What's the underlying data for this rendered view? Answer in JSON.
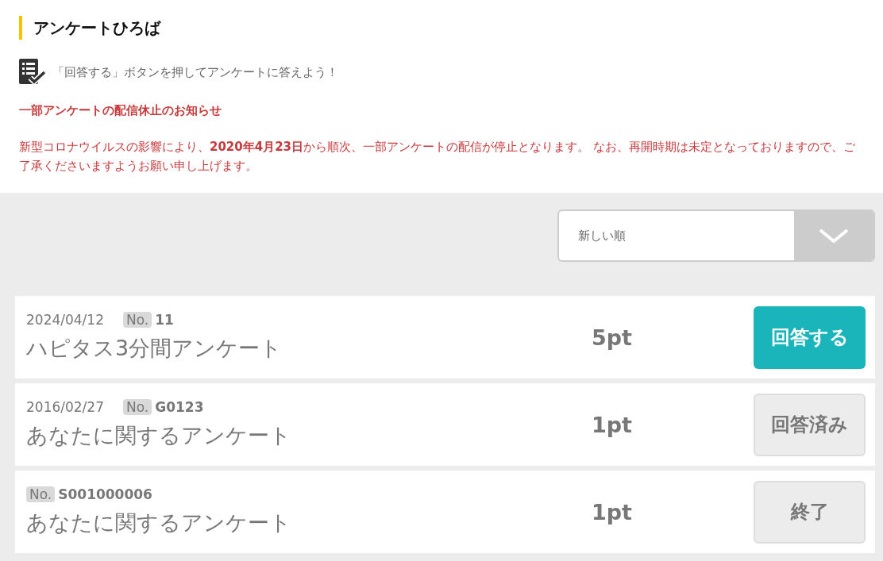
{
  "header": {
    "title": "アンケートひろば",
    "instruction": "「回答する」ボタンを押してアンケートに答えよう！"
  },
  "notice": {
    "title": "一部アンケートの配信休止のお知らせ",
    "body": "新型コロナウイルスの影響により、**2020年4月23日**から順次、一部アンケートの配信が停止となります。 なお、再開時期は未定となっておりますので、ご了承くださいますようお願い申し上げます。"
  },
  "sort": {
    "value": "新しい順"
  },
  "surveys": [
    {
      "date": "2024/04/12",
      "no_label": "No.",
      "no": "11",
      "title": "ハピタス3分間アンケート",
      "points": "5pt",
      "action": {
        "kind": "open",
        "label": "回答する"
      }
    },
    {
      "date": "2016/02/27",
      "no_label": "No.",
      "no": "G0123",
      "title": "あなたに関するアンケート",
      "points": "1pt",
      "action": {
        "kind": "done",
        "label": "回答済み"
      }
    },
    {
      "no_label": "No.",
      "no": "S001000006",
      "title": "あなたに関するアンケート",
      "points": "1pt",
      "action": {
        "kind": "ended",
        "label": "終了"
      }
    }
  ]
}
